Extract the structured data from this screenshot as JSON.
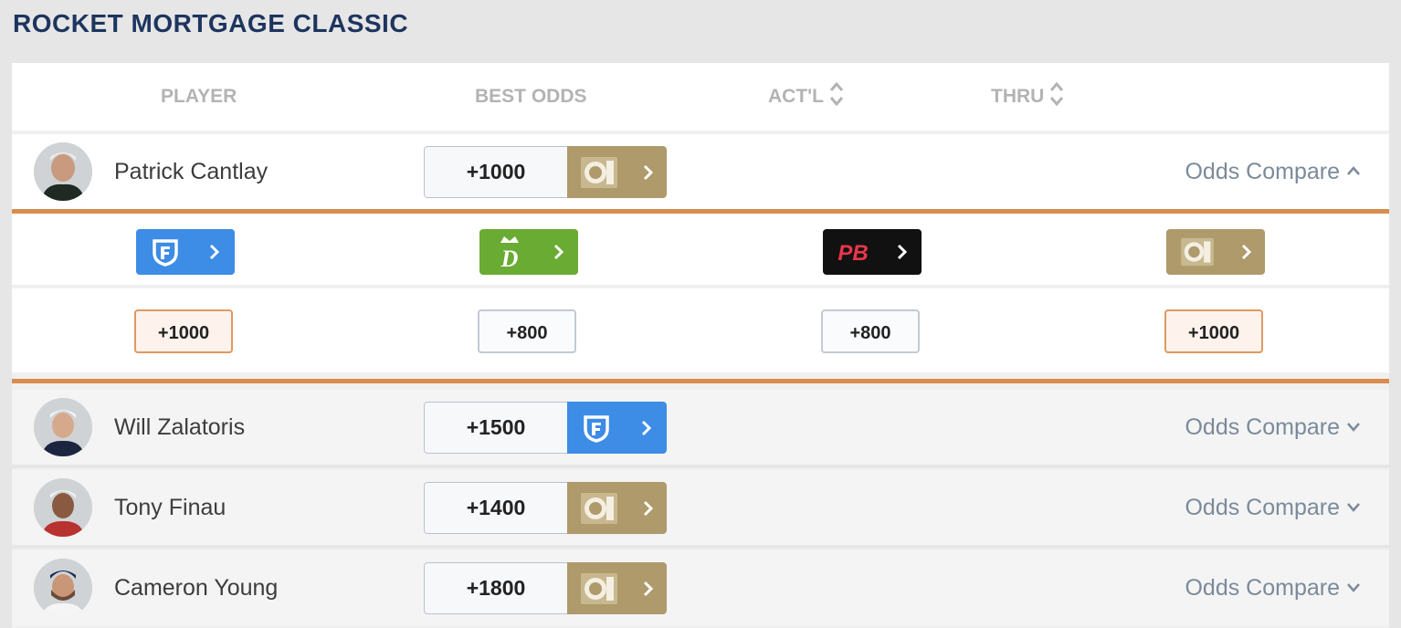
{
  "event_title": "ROCKET MORTGAGE CLASSIC",
  "colors": {
    "navy": "#1d355e",
    "bet_mgm": "#ae9a6a",
    "fanduel": "#3d8ce6",
    "draftkings": "#6aab34",
    "pointsbet": "#111111",
    "accent_orange": "#d98d4c"
  },
  "columns": {
    "player": "PLAYER",
    "best_odds": "BEST ODDS",
    "actual": "ACT'L",
    "thru": "THRU"
  },
  "compare_label": "Odds Compare",
  "players": [
    {
      "name": "Patrick Cantlay",
      "best_odds": "+1000",
      "book": "BetMGM",
      "book_icon": "betmgm-lion-icon",
      "expanded": true
    },
    {
      "name": "Will Zalatoris",
      "best_odds": "+1500",
      "book": "FanDuel",
      "book_icon": "fanduel-shield-icon",
      "expanded": false
    },
    {
      "name": "Tony Finau",
      "best_odds": "+1400",
      "book": "BetMGM",
      "book_icon": "betmgm-lion-icon",
      "expanded": false
    },
    {
      "name": "Cameron Young",
      "best_odds": "+1800",
      "book": "BetMGM",
      "book_icon": "betmgm-lion-icon",
      "expanded": false
    }
  ],
  "compare_books": [
    {
      "book": "FanDuel",
      "icon": "fanduel-shield-icon",
      "logo_text": "",
      "odds": "+1000",
      "best": true
    },
    {
      "book": "DraftKings",
      "icon": "draftkings-crown-icon",
      "logo_text": "D",
      "odds": "+800",
      "best": false
    },
    {
      "book": "PointsBet",
      "icon": "pointsbet-logo-icon",
      "logo_text": "PB",
      "odds": "+800",
      "best": false
    },
    {
      "book": "BetMGM",
      "icon": "betmgm-lion-icon",
      "logo_text": "",
      "odds": "+1000",
      "best": true
    }
  ]
}
